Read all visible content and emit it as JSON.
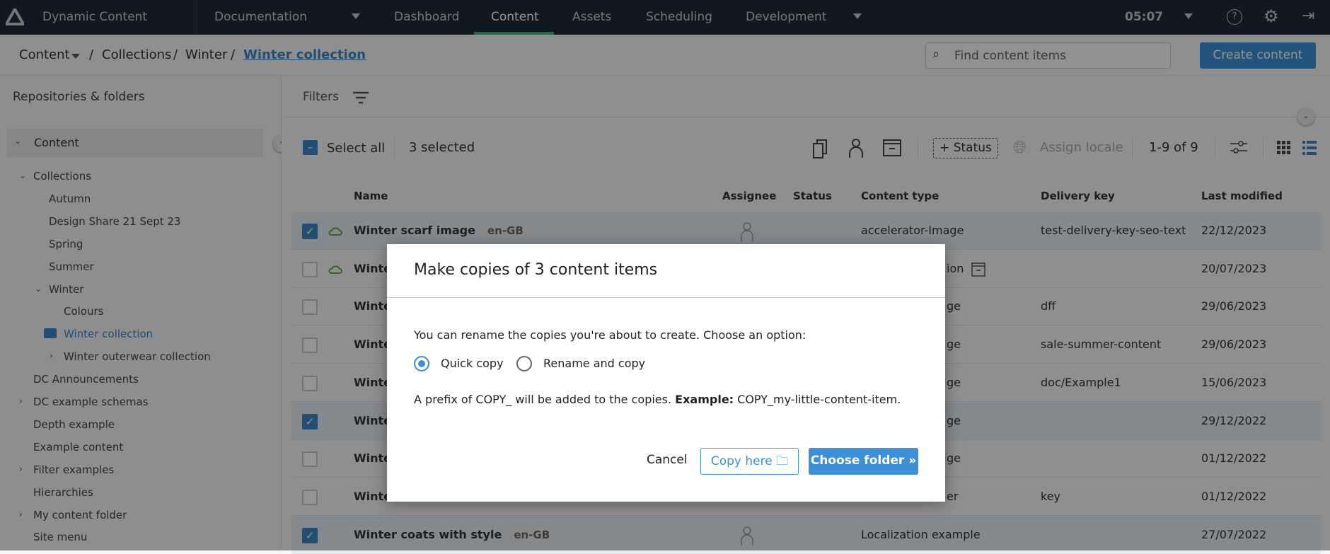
{
  "nav": {
    "app_name": "Dynamic Content",
    "hub": "Documentation",
    "tabs": [
      "Dashboard",
      "Content",
      "Assets",
      "Scheduling",
      "Development"
    ],
    "active_tab": "Content",
    "time": "05:07",
    "accent": "#4caf7d"
  },
  "breadcrumb": {
    "root": "Content",
    "items": [
      "Collections",
      "Winter"
    ],
    "current": "Winter collection"
  },
  "search": {
    "placeholder": "Find content items"
  },
  "create_button": "Create content",
  "sidebar": {
    "title": "Repositories & folders",
    "root": "Content",
    "items": [
      {
        "label": "Collections",
        "level": 0,
        "chevron": "down"
      },
      {
        "label": "Autumn",
        "level": 1
      },
      {
        "label": "Design Share 21 Sept 23",
        "level": 1
      },
      {
        "label": "Spring",
        "level": 1
      },
      {
        "label": "Summer",
        "level": 1
      },
      {
        "label": "Winter",
        "level": 1,
        "chevron": "down"
      },
      {
        "label": "Colours",
        "level": 2
      },
      {
        "label": "Winter collection",
        "level": 2,
        "active": true
      },
      {
        "label": "Winter outerwear collection",
        "level": 2,
        "chevron": "right"
      },
      {
        "label": "DC Announcements",
        "level": 0
      },
      {
        "label": "DC example schemas",
        "level": 0,
        "chevron": "right"
      },
      {
        "label": "Depth example",
        "level": 0
      },
      {
        "label": "Example content",
        "level": 0
      },
      {
        "label": "Filter examples",
        "level": 0,
        "chevron": "right"
      },
      {
        "label": "Hierarchies",
        "level": 0
      },
      {
        "label": "My content folder",
        "level": 0,
        "chevron": "right"
      },
      {
        "label": "Site menu",
        "level": 0
      }
    ]
  },
  "filters_label": "Filters",
  "toolbar": {
    "select_all": "Select all",
    "selected_count": "3 selected",
    "status_button": "+ Status",
    "assign_locale": "Assign locale",
    "pagination": "1-9 of 9"
  },
  "columns": [
    "Name",
    "Assignee",
    "Status",
    "Content type",
    "Delivery key",
    "Last modified"
  ],
  "rows": [
    {
      "selected": true,
      "cloud": true,
      "name": "Winter scarf image",
      "locale": "en-GB",
      "assignee": true,
      "content_type": "accelerator-Image",
      "delivery_key": "test-delivery-key-seo-text",
      "last_modified": "22/12/2023"
    },
    {
      "selected": false,
      "cloud": true,
      "name": "Winter",
      "content_type": "ion",
      "archived": true,
      "delivery_key": "",
      "last_modified": "20/07/2023"
    },
    {
      "selected": false,
      "name": "Winter",
      "content_type": "ge",
      "delivery_key": "dff",
      "last_modified": "29/06/2023"
    },
    {
      "selected": false,
      "name": "Winter",
      "content_type": "ge",
      "delivery_key": "sale-summer-content",
      "last_modified": "29/06/2023"
    },
    {
      "selected": false,
      "name": "Winter",
      "content_type": "ge",
      "delivery_key": "doc/Example1",
      "last_modified": "15/06/2023"
    },
    {
      "selected": true,
      "name": "Winter",
      "content_type": "ge",
      "delivery_key": "",
      "last_modified": "29/12/2022"
    },
    {
      "selected": false,
      "name": "Winter",
      "content_type": "ge",
      "delivery_key": "",
      "last_modified": "01/12/2022"
    },
    {
      "selected": false,
      "name": "Winter",
      "content_type": "er",
      "delivery_key": "key",
      "last_modified": "01/12/2022"
    },
    {
      "selected": true,
      "name": "Winter coats with style",
      "locale": "en-GB",
      "assignee": true,
      "content_type": "Localization example",
      "delivery_key": "",
      "last_modified": "27/07/2022"
    }
  ],
  "modal": {
    "title": "Make copies of 3 content items",
    "intro": "You can rename the copies you're about to create. Choose an option:",
    "options": [
      "Quick copy",
      "Rename and copy"
    ],
    "selected_option": "Quick copy",
    "note_prefix": "A prefix of COPY_ will be added to the copies.",
    "note_example_label": "Example:",
    "note_example": "COPY_my-little-content-item.",
    "cancel": "Cancel",
    "copy_here": "Copy here",
    "choose_folder": "Choose folder »",
    "primary_color": "#3d8fd6"
  }
}
